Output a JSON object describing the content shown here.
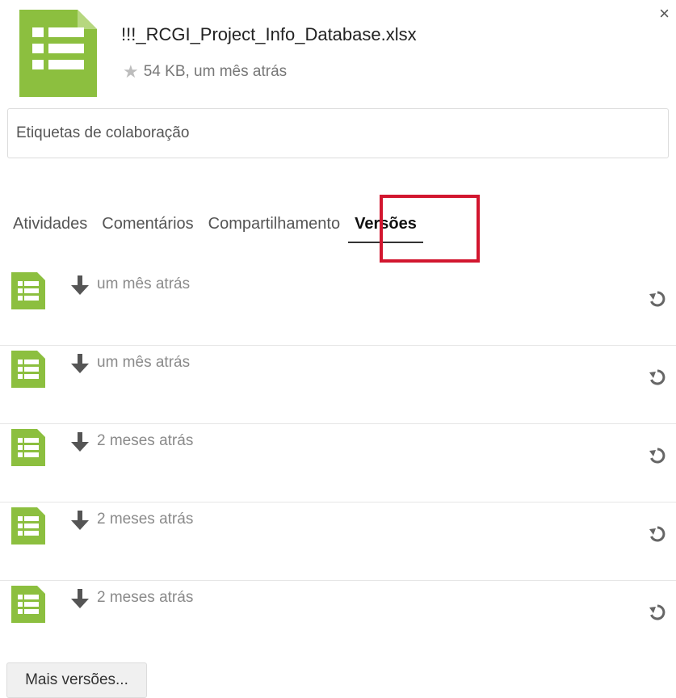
{
  "header": {
    "filename": "!!!_RCGI_Project_Info_Database.xlsx",
    "meta": "54 KB, um mês atrás",
    "close_label": "×"
  },
  "tags": {
    "placeholder": "Etiquetas de colaboração"
  },
  "tabs": [
    {
      "label": "Atividades",
      "active": false
    },
    {
      "label": "Comentários",
      "active": false
    },
    {
      "label": "Compartilhamento",
      "active": false
    },
    {
      "label": "Versões",
      "active": true
    }
  ],
  "versions": [
    {
      "date": "um mês atrás"
    },
    {
      "date": "um mês atrás"
    },
    {
      "date": "2 meses atrás"
    },
    {
      "date": "2 meses atrás"
    },
    {
      "date": "2 meses atrás"
    }
  ],
  "more_button": "Mais versões...",
  "colors": {
    "spreadsheet_green": "#8cbf3f",
    "highlight_red": "#d2162f",
    "icon_gray": "#555555"
  },
  "icons": {
    "file": "spreadsheet-icon",
    "favorite": "star-icon",
    "download": "download-arrow-icon",
    "restore": "restore-icon",
    "close": "close-icon"
  }
}
